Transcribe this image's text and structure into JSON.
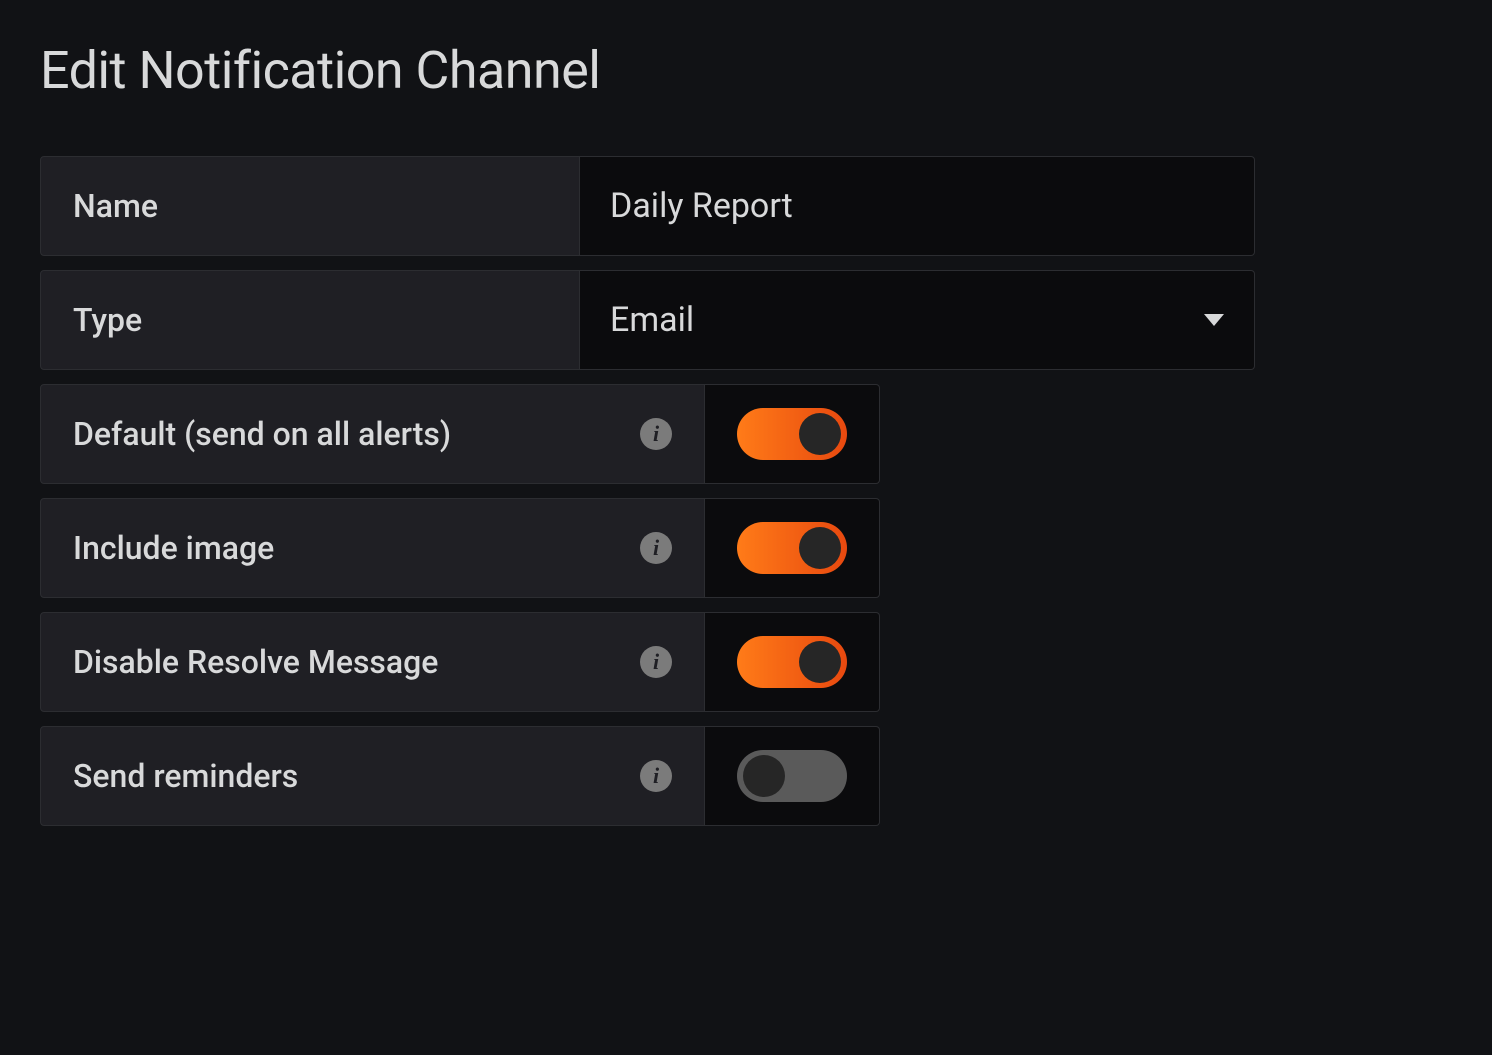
{
  "title": "Edit Notification Channel",
  "fields": {
    "name": {
      "label": "Name",
      "value": "Daily Report"
    },
    "type": {
      "label": "Type",
      "value": "Email"
    }
  },
  "toggles": [
    {
      "key": "default",
      "label": "Default (send on all alerts)",
      "on": true
    },
    {
      "key": "image",
      "label": "Include image",
      "on": true
    },
    {
      "key": "resolve",
      "label": "Disable Resolve Message",
      "on": true
    },
    {
      "key": "remind",
      "label": "Send reminders",
      "on": false
    }
  ]
}
